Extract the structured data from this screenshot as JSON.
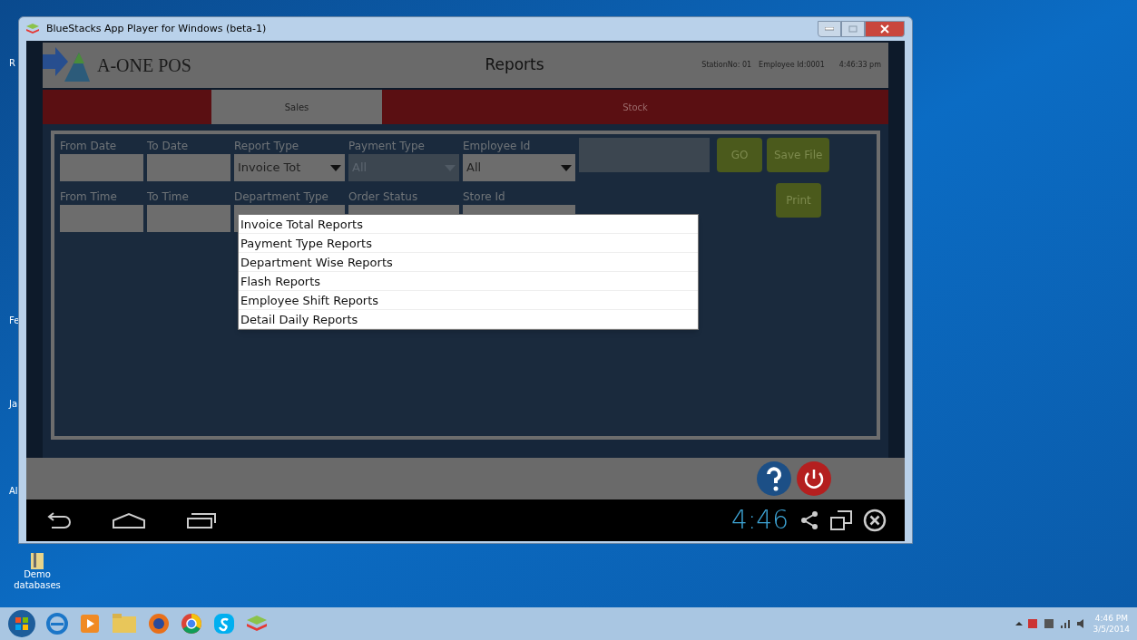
{
  "desktop": {
    "edge_labels": [
      "R",
      "Fe",
      "Ja",
      "Al"
    ],
    "icons": [
      {
        "label": "Demo databases"
      }
    ]
  },
  "window": {
    "title": "BlueStacks App Player for Windows (beta-1)"
  },
  "app": {
    "logo": "A-ONE POS",
    "title": "Reports",
    "station": "StationNo: 01",
    "employee": "Employee Id:0001",
    "time": "4:46:33 pm"
  },
  "tabs": [
    {
      "label": "Sales",
      "selected": true
    },
    {
      "label": "Stock",
      "selected": false
    }
  ],
  "form_rows": [
    {
      "fields": [
        {
          "label": "From Date",
          "kind": "text"
        },
        {
          "label": "To Date",
          "kind": "text"
        },
        {
          "label": "Report Type",
          "kind": "select",
          "value": "Invoice Tot",
          "disabled": false
        },
        {
          "label": "Payment Type",
          "kind": "select",
          "value": "All",
          "disabled": true
        },
        {
          "label": "Employee Id",
          "kind": "select",
          "value": "All",
          "disabled": false
        },
        {
          "kind": "blank"
        }
      ],
      "buttons": [
        "GO",
        "Save File"
      ]
    },
    {
      "fields": [
        {
          "label": "From Time",
          "kind": "text"
        },
        {
          "label": "To Time",
          "kind": "text"
        },
        {
          "label": "Department Type",
          "kind": "select",
          "disabled": false
        },
        {
          "label": "Order Status",
          "kind": "select",
          "disabled": false
        },
        {
          "label": "Store Id",
          "kind": "select",
          "disabled": false
        }
      ],
      "buttons": [
        "Print"
      ]
    }
  ],
  "dropdown_options": [
    "Invoice Total Reports",
    "Payment Type Reports",
    "Department Wise Reports",
    "Flash Reports",
    "Employee Shift Reports",
    "Detail Daily Reports"
  ],
  "android_nav": {
    "clock": "4:46"
  },
  "taskbar": {
    "time": "4:46 PM",
    "date": "3/5/2014"
  }
}
